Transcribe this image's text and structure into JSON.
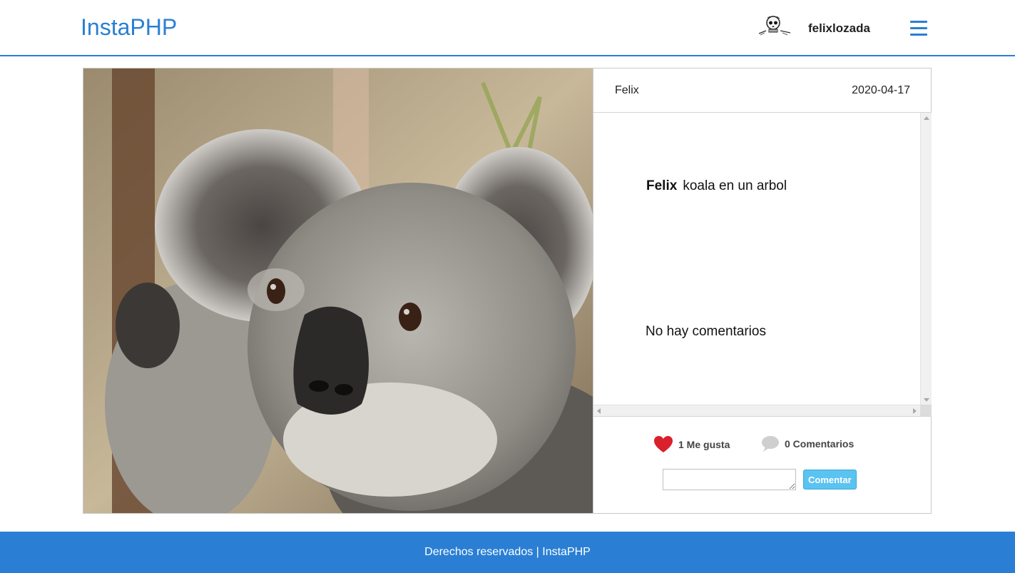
{
  "header": {
    "brand": "InstaPHP",
    "username": "felixlozada",
    "avatar_icon": "skull-icon",
    "menu_icon": "hamburger-menu-icon",
    "accent_color": "#2a7fd4"
  },
  "post": {
    "image_subject": "koala",
    "author": "Felix",
    "date": "2020-04-17",
    "caption_author": "Felix",
    "caption_text": "koala en un arbol",
    "comments_empty": "No hay comentarios",
    "likes_label": "1 Me gusta",
    "comments_label": "0 Comentarios",
    "like_icon": "heart-icon",
    "comment_icon": "speech-bubble-icon",
    "like_color": "#d9202c"
  },
  "comment_form": {
    "input_value": "",
    "submit_label": "Comentar"
  },
  "footer": {
    "text": "Derechos reservados | InstaPHP"
  }
}
